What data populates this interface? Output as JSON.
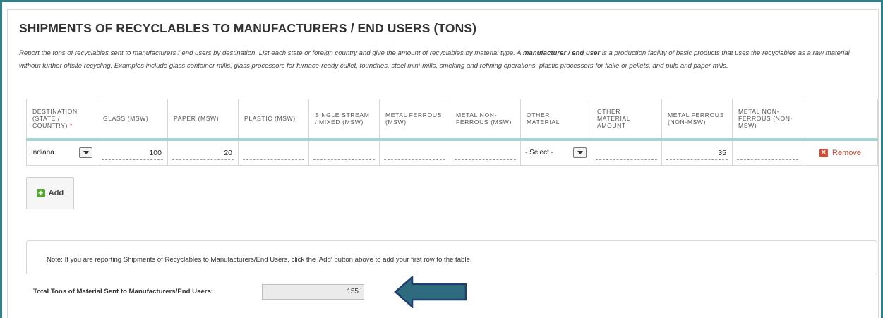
{
  "title": "SHIPMENTS OF RECYCLABLES TO MANUFACTURERS / END USERS (TONS)",
  "description": {
    "part1": "Report the tons of recyclables sent to manufacturers / end users by destination. List each state or foreign country and give the amount of recyclables by material type. A ",
    "bold": "manufacturer / end user",
    "part2": " is a production facility of basic products that uses the recyclables as a raw material without further offsite recycling. Examples include glass container mills, glass processors for furnace-ready cullet, foundries, steel mini-mills, smelting and refining operations, plastic processors for flake or pellets, and pulp and paper mills."
  },
  "table": {
    "headers": [
      "DESTINATION (STATE / COUNTRY)",
      "GLASS (MSW)",
      "PAPER (MSW)",
      "PLASTIC (MSW)",
      "SINGLE STREAM / MIXED (MSW)",
      "METAL FERROUS (MSW)",
      "METAL NON-FERROUS (MSW)",
      "OTHER MATERIAL",
      "OTHER MATERIAL AMOUNT",
      "METAL FERROUS (NON-MSW)",
      "METAL NON-FERROUS (NON-MSW)",
      ""
    ],
    "required_marker": "*",
    "row": {
      "destination": "Indiana",
      "glass": "100",
      "paper": "20",
      "plastic": "",
      "single_stream": "",
      "metal_ferrous": "",
      "metal_non_ferrous": "",
      "other_material": "- Select -",
      "other_material_amount": "",
      "metal_ferrous_non_msw": "35",
      "metal_non_ferrous_non_msw": "",
      "remove_label": "Remove"
    }
  },
  "add_label": "Add",
  "note": "Note: If you are reporting Shipments of Recyclables to Manufacturers/End Users, click the 'Add' button above to add your first row to the table.",
  "total": {
    "label": "Total Tons of Material Sent to Manufacturers/End Users:",
    "value": "155"
  },
  "colors": {
    "frame": "#2f7f86",
    "arrow_fill": "#2e6b7e",
    "arrow_stroke": "#1f3f6e",
    "remove": "#c9503a",
    "add": "#5aa53a"
  },
  "icons": [
    "remove-x-icon",
    "add-plus-icon",
    "dropdown-arrow-icon",
    "pointer-arrow-icon"
  ]
}
